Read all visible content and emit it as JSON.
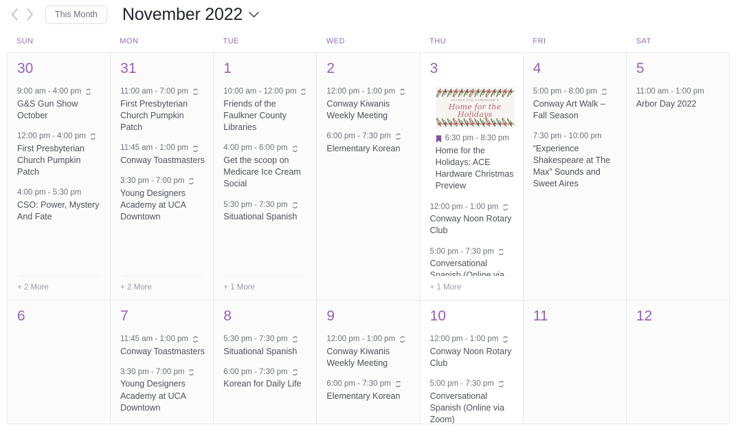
{
  "header": {
    "prev_label": "‹",
    "next_label": "›",
    "this_month_label": "This Month",
    "title": "November 2022",
    "chevron": "chevron-down"
  },
  "weekdays": [
    "SUN",
    "MON",
    "TUE",
    "WED",
    "THU",
    "FRI",
    "SAT"
  ],
  "colors": {
    "accent_purple": "#9461b8",
    "weekday_purple": "#8d6fb0",
    "featured_border": "#9a78bd",
    "grid_line": "#e9eaee",
    "cell_bg": "#fbfbfc",
    "today_bg": "#ffffff",
    "meta_text": "#6e7278",
    "title_text": "#4e5258"
  },
  "featured_image": {
    "line1": "HAYNES ACE HARDWARE'S",
    "line2": "Home for the Holidays",
    "line3": "CHRISTMAS PREVIEW"
  },
  "weeks": [
    {
      "days": [
        {
          "num": "30",
          "today": false,
          "more": "+ 2 More",
          "events": [
            {
              "time": "9:00 am - 4:00 pm",
              "icon": "repeat-icon",
              "title": "G&S Gun Show October"
            },
            {
              "time": "12:00 pm - 4:00 pm",
              "icon": "repeat-icon",
              "title": "First Presbyterian Church Pumpkin Patch"
            },
            {
              "time": "4:00 pm - 5:30 pm",
              "icon": "none",
              "title": "CSO: Power, Mystery And Fate"
            }
          ]
        },
        {
          "num": "31",
          "today": false,
          "more": "+ 2 More",
          "events": [
            {
              "time": "11:00 am - 7:00 pm",
              "icon": "repeat-icon",
              "title": "First Presbyterian Church Pumpkin Patch"
            },
            {
              "time": "11:45 am - 1:00 pm",
              "icon": "repeat-icon",
              "title": "Conway Toastmasters"
            },
            {
              "time": "3:30 pm - 7:00 pm",
              "icon": "repeat-icon",
              "title": "Young Designers Academy at UCA Downtown"
            }
          ]
        },
        {
          "num": "1",
          "today": false,
          "more": "+ 1 More",
          "events": [
            {
              "time": "10:00 am - 12:00 pm",
              "icon": "repeat-icon",
              "title": "Friends of the Faulkner County Libraries"
            },
            {
              "time": "4:00 pm - 6:00 pm",
              "icon": "repeat-icon",
              "title": "Get the scoop on Medicare Ice Cream Social"
            },
            {
              "time": "5:30 pm - 7:30 pm",
              "icon": "repeat-icon",
              "title": "Situational Spanish"
            }
          ]
        },
        {
          "num": "2",
          "today": false,
          "more": "",
          "events": [
            {
              "time": "12:00 pm - 1:00 pm",
              "icon": "repeat-icon",
              "title": "Conway Kiwanis Weekly Meeting"
            },
            {
              "time": "6:00 pm - 7:30 pm",
              "icon": "repeat-icon",
              "title": "Elementary Korean"
            }
          ]
        },
        {
          "num": "3",
          "today": true,
          "more": "+ 1 More",
          "events": [
            {
              "time": "6:30 pm - 8:30 pm",
              "icon": "bookmark-icon",
              "title": "Home for the Holidays: ACE Hardware Christmas Preview",
              "featured": true
            },
            {
              "time": "12:00 pm - 1:00 pm",
              "icon": "repeat-icon",
              "title": "Conway Noon Rotary Club"
            },
            {
              "time": "5:00 pm - 7:30 pm",
              "icon": "repeat-icon",
              "title": "Conversational Spanish (Online via Zoom)"
            }
          ]
        },
        {
          "num": "4",
          "today": false,
          "more": "",
          "events": [
            {
              "time": "5:00 pm - 8:00 pm",
              "icon": "repeat-icon",
              "title": "Conway Art Walk – Fall Season"
            },
            {
              "time": "7:30 pm - 10:00 pm",
              "icon": "none",
              "title": "“Experience Shakespeare at The Max” Sounds and Sweet Aires"
            }
          ]
        },
        {
          "num": "5",
          "today": false,
          "more": "",
          "events": [
            {
              "time": "11:00 am - 1:00 pm",
              "icon": "none",
              "title": "Arbor Day 2022"
            }
          ]
        }
      ]
    },
    {
      "days": [
        {
          "num": "6",
          "today": false,
          "more": "",
          "events": []
        },
        {
          "num": "7",
          "today": false,
          "more": "",
          "events": [
            {
              "time": "11:45 am - 1:00 pm",
              "icon": "repeat-icon",
              "title": "Conway Toastmasters"
            },
            {
              "time": "3:30 pm - 7:00 pm",
              "icon": "repeat-icon",
              "title": "Young Designers Academy at UCA Downtown"
            }
          ]
        },
        {
          "num": "8",
          "today": false,
          "more": "",
          "events": [
            {
              "time": "5:30 pm - 7:30 pm",
              "icon": "repeat-icon",
              "title": "Situational Spanish"
            },
            {
              "time": "6:00 pm - 7:30 pm",
              "icon": "repeat-icon",
              "title": "Korean for Daily Life"
            }
          ]
        },
        {
          "num": "9",
          "today": false,
          "more": "",
          "events": [
            {
              "time": "12:00 pm - 1:00 pm",
              "icon": "repeat-icon",
              "title": "Conway Kiwanis Weekly Meeting"
            },
            {
              "time": "6:00 pm - 7:30 pm",
              "icon": "repeat-icon",
              "title": "Elementary Korean"
            }
          ]
        },
        {
          "num": "10",
          "today": true,
          "more": "",
          "events": [
            {
              "time": "12:00 pm - 1:00 pm",
              "icon": "repeat-icon",
              "title": "Conway Noon Rotary Club"
            },
            {
              "time": "5:00 pm - 7:30 pm",
              "icon": "repeat-icon",
              "title": "Conversational Spanish (Online via Zoom)"
            }
          ]
        },
        {
          "num": "11",
          "today": false,
          "more": "",
          "events": []
        },
        {
          "num": "12",
          "today": false,
          "more": "",
          "events": []
        }
      ]
    }
  ]
}
